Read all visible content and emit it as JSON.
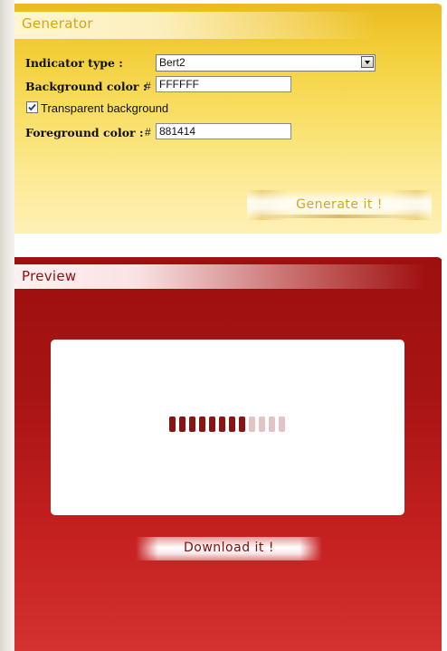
{
  "generator": {
    "title": "Generator",
    "indicator_type_label": "Indicator type :",
    "indicator_type_value": "Bert2",
    "background_color_label": "Background color :",
    "background_color_hash": "#",
    "background_color_value": "FFFFFF",
    "transparent_label": "Transparent background",
    "transparent_checked": true,
    "foreground_color_label": "Foreground color :",
    "foreground_color_hash": "#",
    "foreground_color_value": "881414",
    "generate_label": "Generate it !"
  },
  "preview": {
    "title": "Preview",
    "download_label": "Download it !",
    "loader_bar_count": 12,
    "loader_active_count": 8,
    "loader_active_color": "#881414",
    "loader_inactive_color": "#e2c4c4"
  },
  "colors": {
    "generator_accent": "#dca210",
    "preview_accent": "#8f1010",
    "preview_bg": "#a81414"
  }
}
